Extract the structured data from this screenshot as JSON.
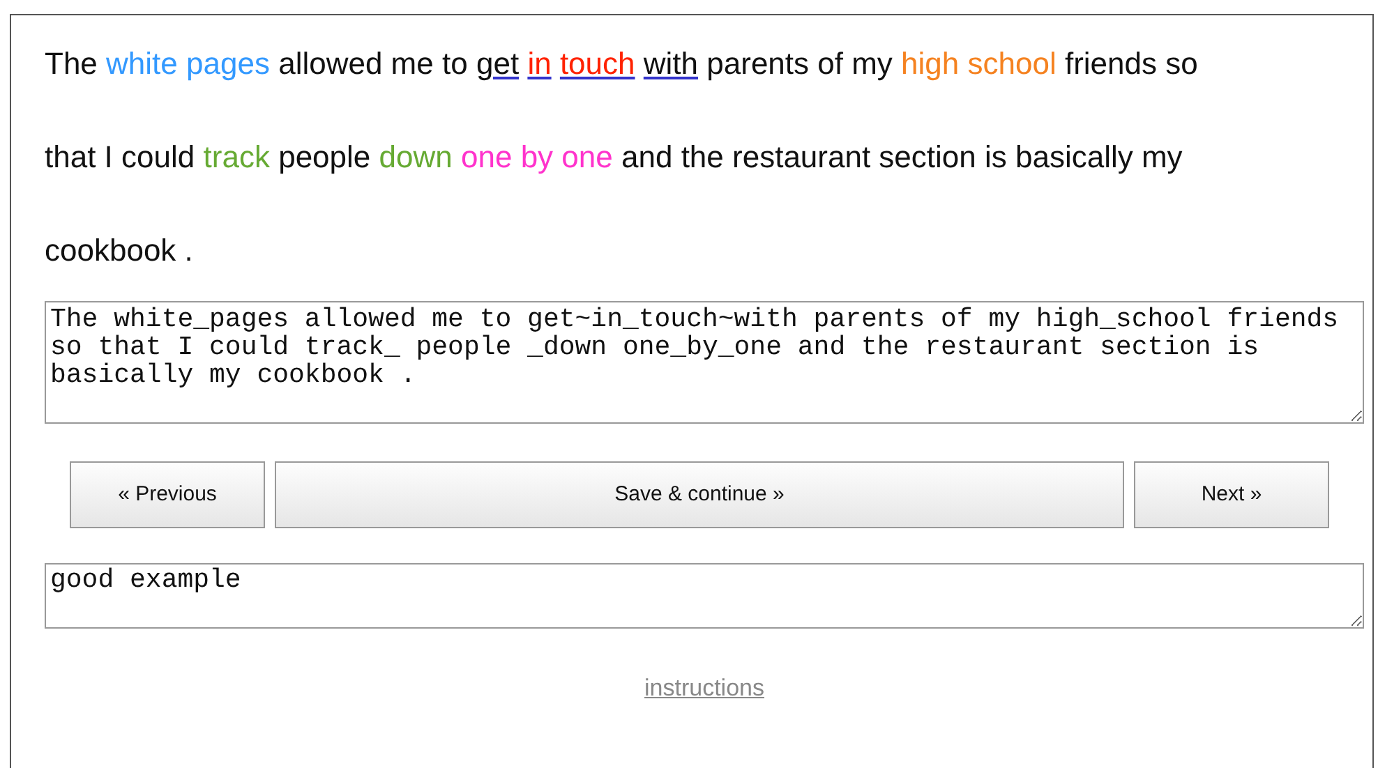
{
  "sentence": [
    {
      "text": "The",
      "color": "#111111",
      "underlined": false
    },
    {
      "text": "white pages",
      "color": "#3399ff",
      "underlined": false
    },
    {
      "text": "allowed me to",
      "color": "#111111",
      "underlined": false
    },
    {
      "text": "get",
      "color": "#111111",
      "underlined": true
    },
    {
      "text": "in",
      "color": "#ff2200",
      "underlined": true
    },
    {
      "text": "touch",
      "color": "#ff2200",
      "underlined": true
    },
    {
      "text": "with",
      "color": "#111111",
      "underlined": true
    },
    {
      "text": "parents of my",
      "color": "#111111",
      "underlined": false
    },
    {
      "text": "high school",
      "color": "#f58220",
      "underlined": false
    },
    {
      "text": "friends so that I could",
      "color": "#111111",
      "underlined": false
    },
    {
      "text": "track",
      "color": "#66aa33",
      "underlined": false
    },
    {
      "text": "people",
      "color": "#111111",
      "underlined": false
    },
    {
      "text": "down",
      "color": "#66aa33",
      "underlined": false
    },
    {
      "text": "one by one",
      "color": "#ff33cc",
      "underlined": false
    },
    {
      "text": "and the restaurant section is basically my cookbook .",
      "color": "#111111",
      "underlined": false
    }
  ],
  "annotation": {
    "value": "The white_pages allowed me to get~in_touch~with parents of my high_school friends so that I could track_ people _down one_by_one and the restaurant section is basically my cookbook ."
  },
  "buttons": [
    {
      "label": "« Previous"
    },
    {
      "label": "Save & continue »"
    },
    {
      "label": "Next »"
    }
  ],
  "comment": {
    "value": "good example"
  },
  "link": "instructions"
}
